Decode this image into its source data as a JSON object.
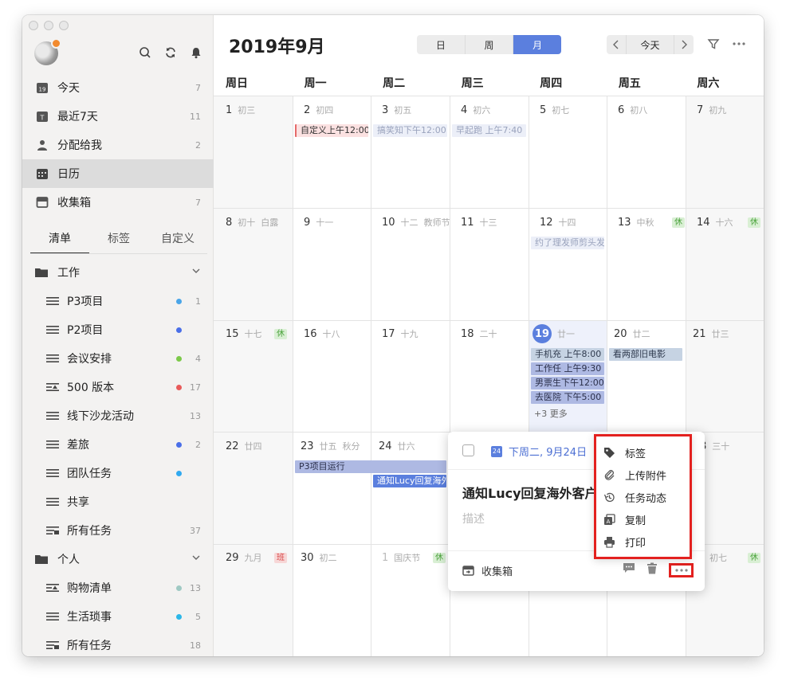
{
  "sidebar": {
    "nav": [
      {
        "label": "今天",
        "count": "7",
        "icon": "calendar-19-icon"
      },
      {
        "label": "最近7天",
        "count": "11",
        "icon": "calendar-7-icon"
      },
      {
        "label": "分配给我",
        "count": "2",
        "icon": "person-icon"
      },
      {
        "label": "日历",
        "count": "",
        "icon": "calendar-grid-icon"
      },
      {
        "label": "收集箱",
        "count": "7",
        "icon": "inbox-icon"
      }
    ],
    "tabs": [
      "清单",
      "标签",
      "自定义"
    ],
    "work_group": "工作",
    "work_items": [
      {
        "label": "P3项目",
        "count": "1",
        "dot": "#4aa5e8"
      },
      {
        "label": "P2项目",
        "count": "",
        "dot": "#4a6fe8"
      },
      {
        "label": "会议安排",
        "count": "4",
        "dot": "#7cc94a"
      },
      {
        "label": "500 版本",
        "count": "17",
        "dot": "#e85a5a"
      },
      {
        "label": "线下沙龙活动",
        "count": "13",
        "dot": ""
      },
      {
        "label": "差旅",
        "count": "2",
        "dot": "#4a6fe8"
      },
      {
        "label": "团队任务",
        "count": "",
        "dot": "#30a9f0"
      },
      {
        "label": "共享",
        "count": "",
        "dot": ""
      },
      {
        "label": "所有任务",
        "count": "37",
        "dot": ""
      }
    ],
    "personal_group": "个人",
    "personal_items": [
      {
        "label": "购物清单",
        "count": "13",
        "dot": "#9fc9c3"
      },
      {
        "label": "生活琐事",
        "count": "5",
        "dot": "#2cb7e8"
      },
      {
        "label": "所有任务",
        "count": "18",
        "dot": ""
      }
    ]
  },
  "header": {
    "title": "2019年9月",
    "views": [
      "日",
      "周",
      "月"
    ],
    "active_view": "月",
    "today_label": "今天"
  },
  "weekdays": [
    "周日",
    "周一",
    "周二",
    "周三",
    "周四",
    "周五",
    "周六"
  ],
  "days": {
    "d1": {
      "num": "1",
      "lunar": "初三"
    },
    "d2": {
      "num": "2",
      "lunar": "初四"
    },
    "d3": {
      "num": "3",
      "lunar": "初五"
    },
    "d4": {
      "num": "4",
      "lunar": "初六"
    },
    "d5": {
      "num": "5",
      "lunar": "初七"
    },
    "d6": {
      "num": "6",
      "lunar": "初八"
    },
    "d7": {
      "num": "7",
      "lunar": "初九"
    },
    "d8": {
      "num": "8",
      "lunar": "初十",
      "fest": "白露"
    },
    "d9": {
      "num": "9",
      "lunar": "十一"
    },
    "d10": {
      "num": "10",
      "lunar": "十二",
      "fest": "教师节"
    },
    "d11": {
      "num": "11",
      "lunar": "十三"
    },
    "d12": {
      "num": "12",
      "lunar": "十四"
    },
    "d13": {
      "num": "13",
      "lunar": "中秋",
      "badge": "休"
    },
    "d14": {
      "num": "14",
      "lunar": "十六",
      "badge": "休"
    },
    "d15": {
      "num": "15",
      "lunar": "十七",
      "badge": "休"
    },
    "d16": {
      "num": "16",
      "lunar": "十八"
    },
    "d17": {
      "num": "17",
      "lunar": "十九"
    },
    "d18": {
      "num": "18",
      "lunar": "二十"
    },
    "d19": {
      "num": "19",
      "lunar": "廿一"
    },
    "d20": {
      "num": "20",
      "lunar": "廿二"
    },
    "d21": {
      "num": "21",
      "lunar": "廿三"
    },
    "d22": {
      "num": "22",
      "lunar": "廿四"
    },
    "d23": {
      "num": "23",
      "lunar": "廿五",
      "fest": "秋分"
    },
    "d24": {
      "num": "24",
      "lunar": "廿六"
    },
    "d28": {
      "num": "8",
      "lunar": "三十"
    },
    "d29": {
      "num": "29",
      "lunar": "九月",
      "badge": "班"
    },
    "d30": {
      "num": "30",
      "lunar": "初二"
    },
    "o1": {
      "num": "1",
      "lunar": "国庆节",
      "badge": "休"
    },
    "o5": {
      "lunar": "初七",
      "badge": "休"
    }
  },
  "events": {
    "e2": "自定义上午12:00",
    "e3": "搞笑知下午12:00",
    "e4": "早起跑 上午7:40",
    "e12": "约了理发师剪头发",
    "e19a": "手机充 上午8:00",
    "e19b": "工作任 上午9:30",
    "e19c": "男票生下午12:00",
    "e19d": "去医院 下午5:00",
    "e19more": "+3 更多",
    "e20": "看两部旧电影",
    "e23": "P3项目运行",
    "e24": "通知Lucy回复海外客户"
  },
  "popover": {
    "date": "下周二, 9月24日",
    "cal_day": "24",
    "title": "通知Lucy回复海外客户",
    "desc_placeholder": "描述",
    "list": "收集箱"
  },
  "menu": [
    "标签",
    "上传附件",
    "任务动态",
    "复制",
    "打印"
  ],
  "colors": {
    "accent": "#5b7fde",
    "highlight": "#e3211f"
  }
}
